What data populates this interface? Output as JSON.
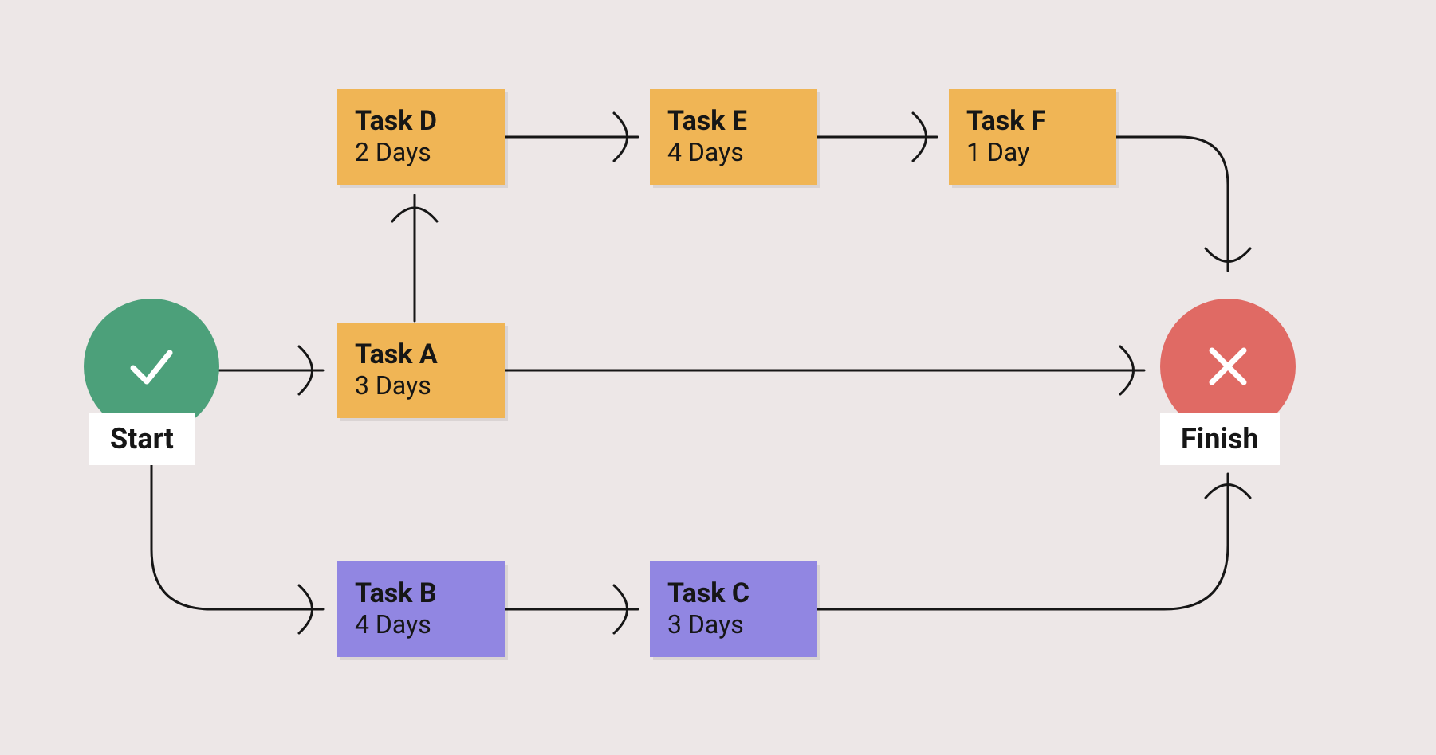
{
  "start": {
    "label": "Start"
  },
  "finish": {
    "label": "Finish"
  },
  "tasks": {
    "A": {
      "name": "Task A",
      "duration": "3 Days",
      "color": "orange"
    },
    "B": {
      "name": "Task B",
      "duration": "4 Days",
      "color": "purple"
    },
    "C": {
      "name": "Task C",
      "duration": "3 Days",
      "color": "purple"
    },
    "D": {
      "name": "Task D",
      "duration": "2 Days",
      "color": "orange"
    },
    "E": {
      "name": "Task E",
      "duration": "4 Days",
      "color": "orange"
    },
    "F": {
      "name": "Task F",
      "duration": "1 Day",
      "color": "orange"
    }
  },
  "edges": [
    [
      "Start",
      "A"
    ],
    [
      "Start",
      "B"
    ],
    [
      "A",
      "D"
    ],
    [
      "A",
      "Finish"
    ],
    [
      "D",
      "E"
    ],
    [
      "E",
      "F"
    ],
    [
      "F",
      "Finish"
    ],
    [
      "B",
      "C"
    ],
    [
      "C",
      "Finish"
    ]
  ],
  "colors": {
    "background": "#ede7e7",
    "task_orange": "#f0b555",
    "task_purple": "#9186e2",
    "start_green": "#4ca07a",
    "finish_red": "#e06a64",
    "stroke": "#161616",
    "label_bg": "#ffffff"
  }
}
